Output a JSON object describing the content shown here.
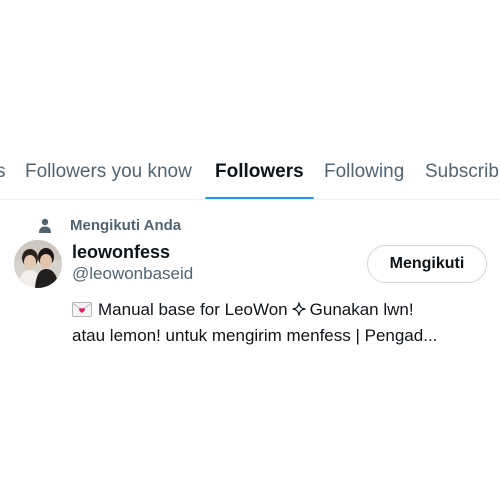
{
  "tabs": [
    {
      "label": "s",
      "active": false
    },
    {
      "label": "Followers you know",
      "active": false
    },
    {
      "label": "Followers",
      "active": true
    },
    {
      "label": "Following",
      "active": false
    },
    {
      "label": "Subscrib",
      "active": false
    }
  ],
  "colors": {
    "accent": "#1d9bf0",
    "text_primary": "#0f1419",
    "text_secondary": "#536471",
    "border": "#cfd9de"
  },
  "user": {
    "context": "Mengikuti Anda",
    "context_icon": "person-icon",
    "display_name": "leowonfess",
    "handle": "@leowonbaseid",
    "follow_button": "Mengikuti",
    "bio_line1_a": "Manual base for LeoWon",
    "bio_line1_b": "Gunakan lwn!",
    "bio_line2": "atau lemon! untuk mengirim menfess | Pengad...",
    "bio_icons": [
      "love-letter-icon",
      "sparkle-icon"
    ]
  }
}
